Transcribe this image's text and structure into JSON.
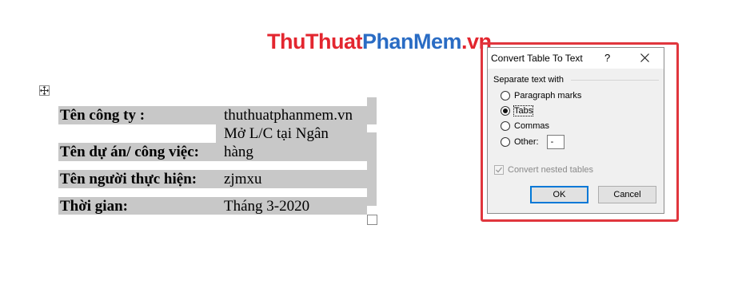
{
  "logo": {
    "part1": "ThuThuat",
    "part2": "PhanMem",
    "part3": ".vn"
  },
  "table": {
    "rows": [
      {
        "label": "Tên công ty :",
        "value": "thuthuatphanmem.vn"
      },
      {
        "label": "Tên dự án/ công việc:",
        "value_line1": "Mở L/C tại Ngân",
        "value_line2": "hàng"
      },
      {
        "label": "Tên người thực hiện:",
        "value": "zjmxu"
      },
      {
        "label": "Thời gian:",
        "value": "Tháng 3-2020"
      }
    ]
  },
  "dialog": {
    "title": "Convert Table To Text",
    "help": "?",
    "group_label": "Separate text with",
    "options": [
      {
        "label": "Paragraph marks",
        "selected": false
      },
      {
        "label": "Tabs",
        "selected": true
      },
      {
        "label": "Commas",
        "selected": false
      },
      {
        "label": "Other:",
        "selected": false
      }
    ],
    "other_value": "-",
    "nested_label": "Convert nested tables",
    "nested_checked": true,
    "nested_enabled": false,
    "ok_label": "OK",
    "cancel_label": "Cancel"
  },
  "colors": {
    "highlight": "#e0363d",
    "logo_red": "#e3262f",
    "logo_blue": "#2a6cc4",
    "shading": "#c8c8c8"
  }
}
